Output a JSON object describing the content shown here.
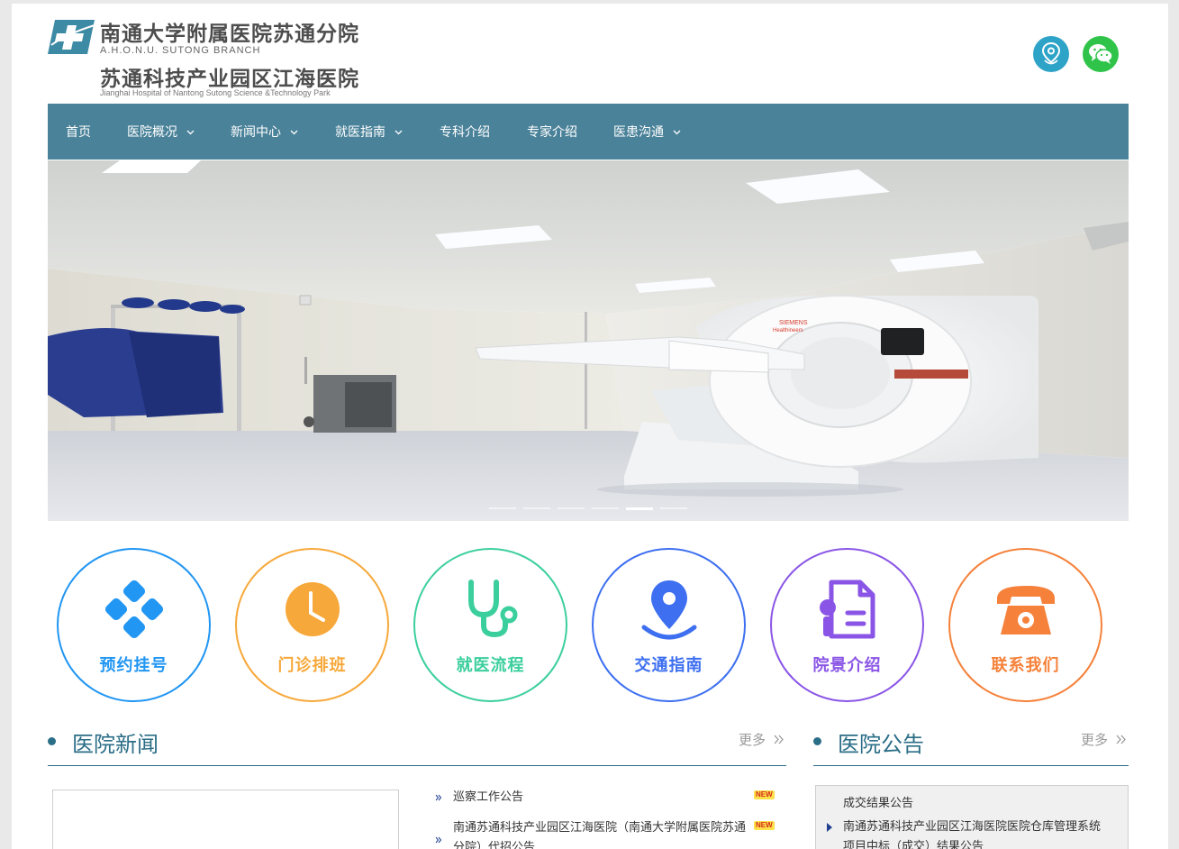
{
  "header": {
    "logo": {
      "cn_line1": "南通大学附属医院苏通分院",
      "en_line1": "A.H.O.N.U. SUTONG BRANCH",
      "cn_line2": "苏通科技产业园区江海医院",
      "en_line2": "Jianghai Hospital of Nantong Sutong Science &Technology Park"
    },
    "icons": [
      "location-icon",
      "wechat-icon"
    ],
    "colors": {
      "location": "#2ea3c8",
      "wechat": "#2fc449"
    }
  },
  "nav": {
    "color": "#4a8299",
    "items": [
      {
        "label": "首页",
        "has_dropdown": false
      },
      {
        "label": "医院概况",
        "has_dropdown": true
      },
      {
        "label": "新闻中心",
        "has_dropdown": true
      },
      {
        "label": "就医指南",
        "has_dropdown": true
      },
      {
        "label": "专科介绍",
        "has_dropdown": false
      },
      {
        "label": "专家介绍",
        "has_dropdown": false
      },
      {
        "label": "医患沟通",
        "has_dropdown": true
      }
    ]
  },
  "banner": {
    "slide_count": 6,
    "active_slide": 5
  },
  "services": [
    {
      "label": "预约挂号",
      "icon": "appointment-icon",
      "color": "#2196f3"
    },
    {
      "label": "门诊排班",
      "icon": "clock-icon",
      "color": "#f7a83a"
    },
    {
      "label": "就医流程",
      "icon": "stethoscope-icon",
      "color": "#3ccf9e"
    },
    {
      "label": "交通指南",
      "icon": "map-pin-icon",
      "color": "#3d6ff0"
    },
    {
      "label": "院景介绍",
      "icon": "certificate-icon",
      "color": "#8a55e6"
    },
    {
      "label": "联系我们",
      "icon": "telephone-icon",
      "color": "#f5813a"
    }
  ],
  "news": {
    "title": "医院新闻",
    "more": "更多",
    "items": [
      {
        "text": "巡察工作公告",
        "badge": "NEW"
      },
      {
        "text": "南通苏通科技产业园区江海医院（南通大学附属医院苏通分院）代招公告",
        "badge": "NEW"
      }
    ]
  },
  "notices": {
    "title": "医院公告",
    "more": "更多",
    "items": [
      {
        "text": "成交结果公告",
        "bullet": false
      },
      {
        "text": "南通苏通科技产业园区江海医院医院仓库管理系统项目中标（成交）结果公告",
        "bullet": true
      }
    ]
  }
}
